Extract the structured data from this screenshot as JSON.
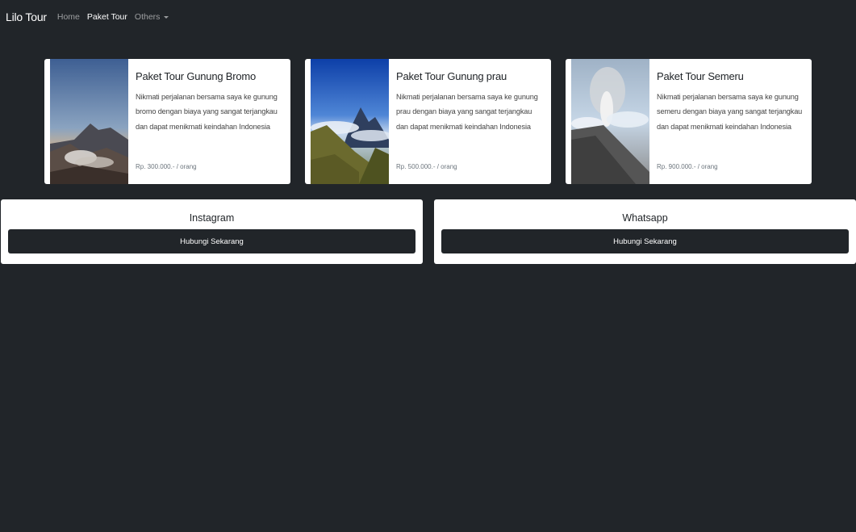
{
  "navbar": {
    "brand": "Lilo Tour",
    "links": [
      "Home",
      "Paket Tour"
    ],
    "dropdown_label": "Others"
  },
  "tours": [
    {
      "title": "Paket Tour Gunung Bromo",
      "description": "Nikmati perjalanan bersama saya ke gunung bromo dengan biaya yang sangat terjangkau dan dapat menikmati keindahan Indonesia",
      "price": "Rp. 300.000.- / orang"
    },
    {
      "title": "Paket Tour Gunung prau",
      "description": "Nikmati perjalanan bersama saya ke gunung prau dengan biaya yang sangat terjangkau dan dapat menikmati keindahan Indonesia",
      "price": "Rp. 500.000.- / orang"
    },
    {
      "title": "Paket Tour Semeru",
      "description": "Nikmati perjalanan bersama saya ke gunung semeru dengan biaya yang sangat terjangkau dan dapat menikmati keindahan Indonesia",
      "price": "Rp. 900.000.- / orang"
    }
  ],
  "contacts": [
    {
      "title": "Instagram",
      "button": "Hubungi Sekarang"
    },
    {
      "title": "Whatsapp",
      "button": "Hubungi Sekarang"
    }
  ],
  "colors": {
    "background": "#212529",
    "card": "#ffffff",
    "button": "#212529"
  }
}
